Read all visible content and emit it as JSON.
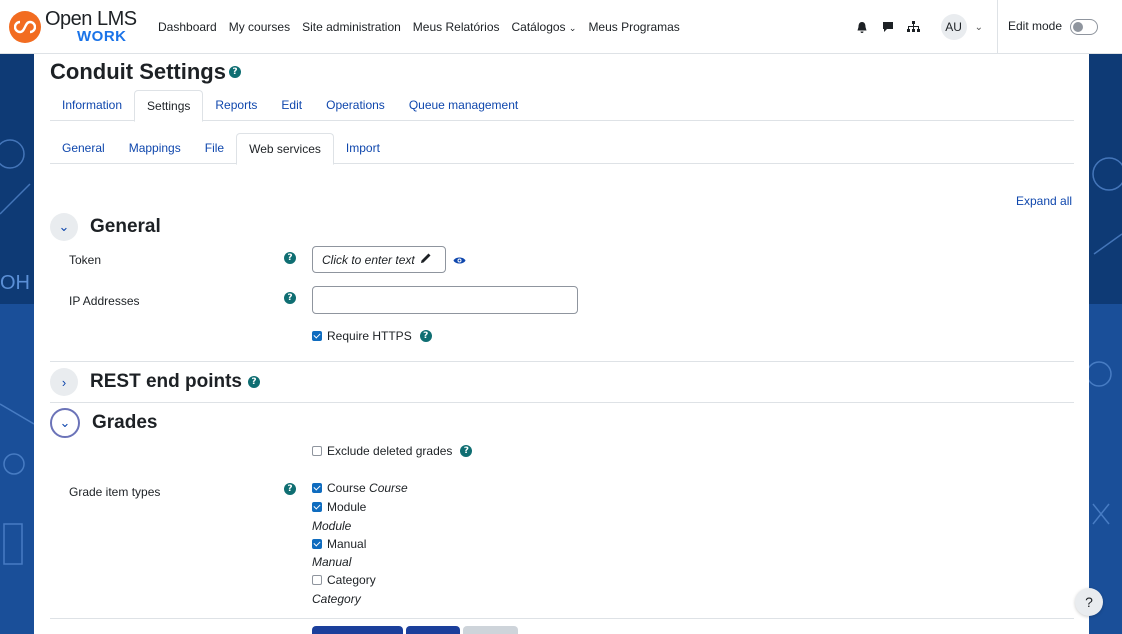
{
  "logo": {
    "main": "Open LMS",
    "sub": "WORK"
  },
  "nav": {
    "links": [
      "Dashboard",
      "My courses",
      "Site administration",
      "Meus Relatórios",
      "Catálogos",
      "Meus Programas"
    ],
    "avatar": "AU",
    "edit_mode_label": "Edit mode",
    "edit_mode_on": false
  },
  "page": {
    "title": "Conduit Settings"
  },
  "tabs_primary": [
    "Information",
    "Settings",
    "Reports",
    "Edit",
    "Operations",
    "Queue management"
  ],
  "tabs_primary_active": "Settings",
  "tabs_secondary": [
    "General",
    "Mappings",
    "File",
    "Web services",
    "Import"
  ],
  "tabs_secondary_active": "Web services",
  "expand_all": "Expand all",
  "general": {
    "title": "General",
    "token_label": "Token",
    "token_placeholder": "Click to enter text",
    "ip_label": "IP Addresses",
    "ip_value": "",
    "require_https_label": "Require HTTPS",
    "require_https_checked": true
  },
  "rest": {
    "title": "REST end points"
  },
  "grades": {
    "title": "Grades",
    "exclude_deleted_label": "Exclude deleted grades",
    "exclude_deleted_checked": false,
    "grade_types_label": "Grade item types",
    "course_label": "Course",
    "course_italic": "Course",
    "course_checked": true,
    "module_label": "Module",
    "module_italic": "Module",
    "module_checked": true,
    "manual_label": "Manual",
    "manual_italic": "Manual",
    "manual_checked": true,
    "category_label": "Category",
    "category_italic": "Category",
    "category_checked": false
  },
  "help_fab": "?",
  "colors": {
    "accent": "#0f6cbf",
    "link": "#0f47ad",
    "help_icon": "#0f6e72",
    "logo_orange": "#f26c21",
    "logo_blue": "#1a73e8",
    "bg": "#0f3c78"
  },
  "icons": [
    "bell-icon",
    "chat-icon",
    "sitemap-icon",
    "pencil-icon",
    "eye-icon",
    "help-icon",
    "chevron-down-icon",
    "chevron-right-icon"
  ]
}
